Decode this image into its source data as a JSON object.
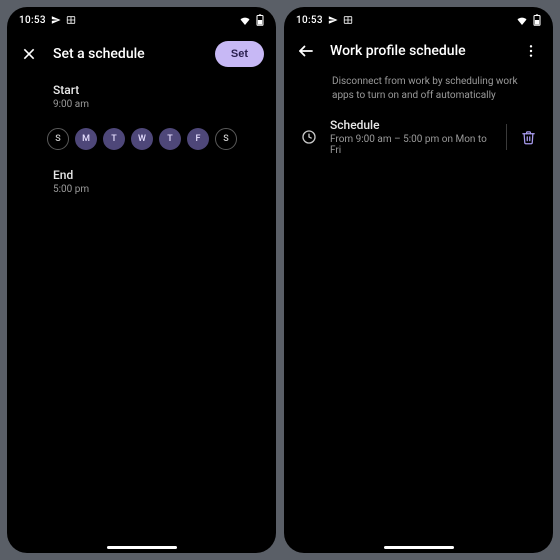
{
  "status": {
    "time": "10:53"
  },
  "left": {
    "title": "Set a schedule",
    "set_button": "Set",
    "start_label": "Start",
    "start_value": "9:00 am",
    "end_label": "End",
    "end_value": "5:00 pm",
    "days": [
      {
        "letter": "S",
        "on": false
      },
      {
        "letter": "M",
        "on": true
      },
      {
        "letter": "T",
        "on": true
      },
      {
        "letter": "W",
        "on": true
      },
      {
        "letter": "T",
        "on": true
      },
      {
        "letter": "F",
        "on": true
      },
      {
        "letter": "S",
        "on": false
      }
    ]
  },
  "right": {
    "title": "Work profile schedule",
    "description": "Disconnect from work by scheduling work apps to turn on and off automatically",
    "schedule_label": "Schedule",
    "schedule_value": "From 9:00 am – 5:00 pm on Mon to Fri"
  },
  "colors": {
    "accent": "#a99cf0",
    "day_on_bg": "#4e4779",
    "set_bg": "#c7b8f5"
  }
}
